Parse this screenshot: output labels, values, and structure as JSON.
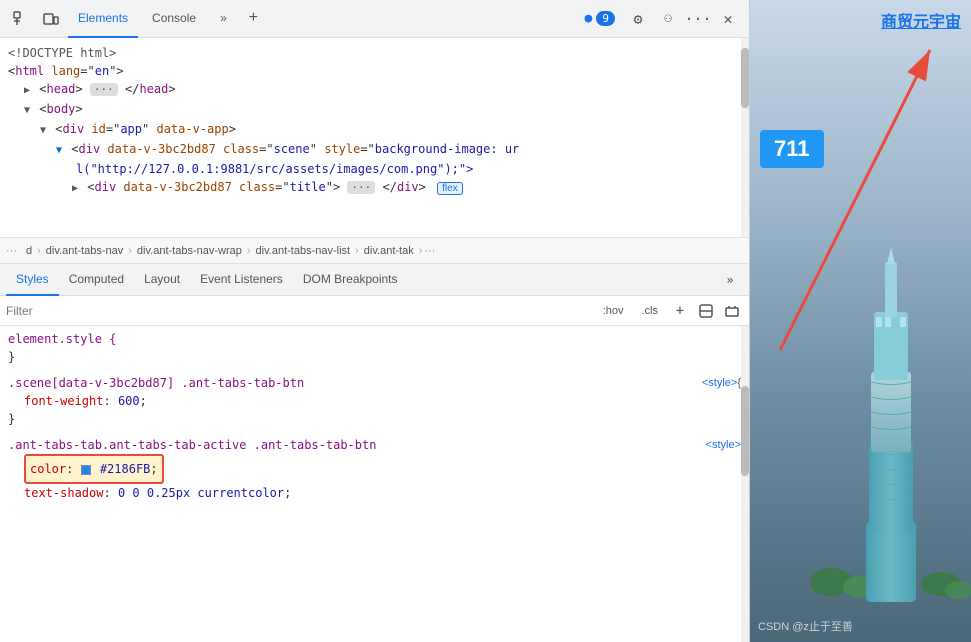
{
  "devtools": {
    "top_tabs": [
      {
        "id": "elements",
        "label": "Elements",
        "active": true
      },
      {
        "id": "console",
        "label": "Console",
        "active": false
      }
    ],
    "badge_count": "9",
    "icons": {
      "inspect": "⬚",
      "device": "⬜",
      "more_tabs": "»",
      "add_tab": "+",
      "gear": "⚙",
      "person": "⚇",
      "more": "···",
      "close": "✕",
      "chevron_right": "»"
    },
    "dom_tree": {
      "lines": [
        {
          "indent": 0,
          "content": "<!DOCTYPE html>"
        },
        {
          "indent": 0,
          "content": "<html lang=\"en\">"
        },
        {
          "indent": 2,
          "content": "▶ <head> ··· </head>"
        },
        {
          "indent": 2,
          "content": "▼ <body>"
        },
        {
          "indent": 4,
          "content": "▼ <div id=\"app\" data-v-app>"
        },
        {
          "indent": 6,
          "content": "▼ <div data-v-3bc2bd87 class=\"scene\" style=\"background-image: ur"
        },
        {
          "indent": 8,
          "content": "l(\"http://127.0.0.1:9881/src/assets/images/com.png\");\">"
        },
        {
          "indent": 6,
          "content": "▶ <div data-v-3bc2bd87 class=\"title\"> ··· </div>"
        },
        {
          "indent": 0,
          "flex_badge": true
        }
      ]
    },
    "breadcrumb": {
      "dots": "...",
      "items": [
        "d",
        "div.ant-tabs-nav",
        "div.ant-tabs-nav-wrap",
        "div.ant-tabs-nav-list",
        "div.ant-tak",
        "..."
      ]
    },
    "style_tabs": [
      {
        "id": "styles",
        "label": "Styles",
        "active": true
      },
      {
        "id": "computed",
        "label": "Computed",
        "active": false
      },
      {
        "id": "layout",
        "label": "Layout",
        "active": false
      },
      {
        "id": "event_listeners",
        "label": "Event Listeners",
        "active": false
      },
      {
        "id": "dom_breakpoints",
        "label": "DOM Breakpoints",
        "active": false
      }
    ],
    "filter": {
      "placeholder": "Filter",
      "hov_btn": ":hov",
      "cls_btn": ".cls",
      "plus_btn": "+",
      "force_state_btn": "⬒",
      "toggle_btn": "⬓"
    },
    "css_rules": [
      {
        "id": "element_style",
        "selector": "element.style {",
        "close": "}",
        "props": []
      },
      {
        "id": "scene_rule",
        "selector": ".scene[data-v-3bc2bd87] .ant-tabs-tab-btn",
        "source": "<style>",
        "open": "{",
        "close": "}",
        "props": [
          {
            "name": "font-weight",
            "value": "600",
            "separator": ":"
          }
        ]
      },
      {
        "id": "active_rule",
        "selector": ".ant-tabs-tab.ant-tabs-tab-active .ant-tabs-tab-btn",
        "source": "<style>",
        "open": "{",
        "close": "}",
        "props": [
          {
            "name": "color",
            "value": "#2186FB",
            "has_swatch": true,
            "swatch_color": "#2186fb",
            "highlighted": true
          },
          {
            "name": "text-shadow",
            "value": "0 0 0.25px currentcolor"
          }
        ]
      }
    ]
  },
  "preview": {
    "title": "商贸元宇宙",
    "badge_number": "711",
    "csdn_watermark": "CSDN @z止于至善"
  }
}
